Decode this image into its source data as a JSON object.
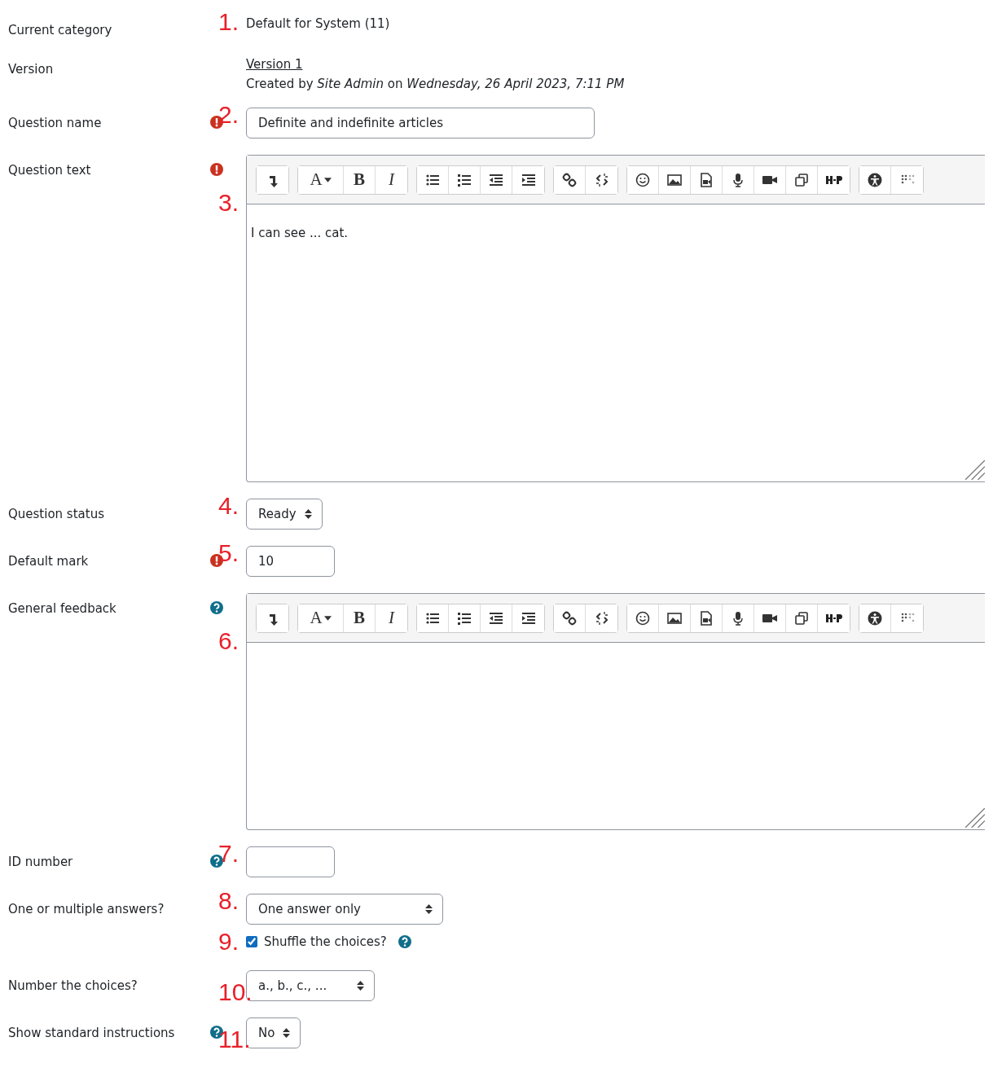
{
  "fields": [
    {
      "kind": "static",
      "label": "Current category",
      "value": "Default for System (11)",
      "marker": "1."
    },
    {
      "kind": "version",
      "label": "Version",
      "link": "Version 1",
      "created": "Created by *Site Admin* on *Wednesday, 26 April 2023, 7:11 PM*"
    },
    {
      "kind": "text",
      "label": "Question name",
      "value": "Definite and indefinite articles",
      "required": true,
      "marker": "2."
    },
    {
      "kind": "editor",
      "label": "Question text",
      "value": "I can see ... cat.",
      "required": true,
      "marker": "3.",
      "toolbar": [
        [
          {
            "kind": "arrow"
          }
        ],
        [
          {
            "kind": "font",
            "glyph": "A"
          },
          {
            "kind": "bold",
            "glyph": "B"
          },
          {
            "kind": "italic",
            "glyph": "I"
          }
        ],
        [
          {
            "kind": "ul"
          },
          {
            "kind": "ol"
          },
          {
            "kind": "outdent"
          },
          {
            "kind": "indent"
          }
        ],
        [
          {
            "kind": "link"
          },
          {
            "kind": "unlink"
          }
        ],
        [
          {
            "kind": "emoji"
          },
          {
            "kind": "image"
          },
          {
            "kind": "media"
          },
          {
            "kind": "mic"
          },
          {
            "kind": "video"
          },
          {
            "kind": "copy"
          },
          {
            "kind": "h5p"
          }
        ],
        [
          {
            "kind": "access"
          },
          {
            "kind": "dots"
          }
        ]
      ]
    },
    {
      "kind": "select",
      "label": "Question status",
      "value": "Ready",
      "marker": "4."
    },
    {
      "kind": "text",
      "label": "Default mark",
      "value": "10",
      "required": true,
      "marker": "5."
    },
    {
      "kind": "editor",
      "label": "General feedback",
      "help": true,
      "marker": "6.",
      "toolbar": [
        [
          {
            "kind": "arrow"
          }
        ],
        [
          {
            "kind": "font",
            "glyph": "A"
          },
          {
            "kind": "bold",
            "glyph": "B"
          },
          {
            "kind": "italic",
            "glyph": "I"
          }
        ],
        [
          {
            "kind": "ul"
          },
          {
            "kind": "ol"
          },
          {
            "kind": "outdent"
          },
          {
            "kind": "indent"
          }
        ],
        [
          {
            "kind": "link"
          },
          {
            "kind": "unlink"
          }
        ],
        [
          {
            "kind": "emoji"
          },
          {
            "kind": "image"
          },
          {
            "kind": "media"
          },
          {
            "kind": "mic"
          },
          {
            "kind": "video"
          },
          {
            "kind": "copy"
          },
          {
            "kind": "h5p"
          }
        ],
        [
          {
            "kind": "access"
          },
          {
            "kind": "dots"
          }
        ]
      ]
    },
    {
      "kind": "text",
      "label": "ID number",
      "help": true,
      "marker": "7."
    },
    {
      "kind": "select",
      "label": "One or multiple answers?",
      "value": "One answer only",
      "marker": "8."
    },
    {
      "kind": "checkbox",
      "label_text": "Shuffle the choices?",
      "checked": true,
      "help": true,
      "marker": "9."
    },
    {
      "kind": "select",
      "label": "Number the choices?",
      "value": "a., b., c., ...",
      "marker": "10."
    },
    {
      "kind": "select",
      "label": "Show standard instructions",
      "value": "No",
      "help": true,
      "marker": "11."
    }
  ]
}
